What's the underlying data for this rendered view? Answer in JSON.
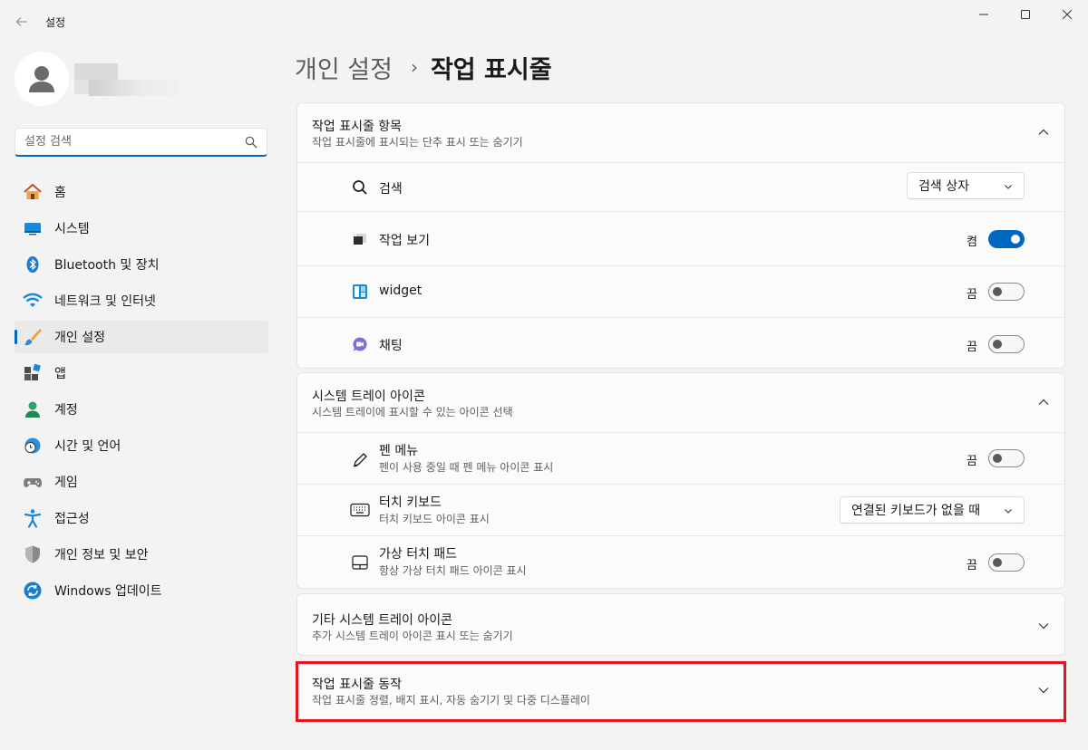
{
  "window": {
    "title": "설정"
  },
  "search": {
    "placeholder": "설정 검색"
  },
  "nav": {
    "items": [
      {
        "label": "홈",
        "icon": "home-icon"
      },
      {
        "label": "시스템",
        "icon": "system-icon"
      },
      {
        "label": "Bluetooth 및 장치",
        "icon": "bluetooth-icon"
      },
      {
        "label": "네트워크 및 인터넷",
        "icon": "wifi-icon"
      },
      {
        "label": "개인 설정",
        "icon": "brush-icon",
        "active": true
      },
      {
        "label": "앱",
        "icon": "apps-icon"
      },
      {
        "label": "계정",
        "icon": "account-icon"
      },
      {
        "label": "시간 및 언어",
        "icon": "clock-globe-icon"
      },
      {
        "label": "게임",
        "icon": "gamepad-icon"
      },
      {
        "label": "접근성",
        "icon": "accessibility-icon"
      },
      {
        "label": "개인 정보 및 보안",
        "icon": "shield-icon"
      },
      {
        "label": "Windows 업데이트",
        "icon": "update-icon"
      }
    ]
  },
  "breadcrumb": {
    "parent": "개인 설정",
    "separator": "›",
    "current": "작업 표시줄"
  },
  "taskbar_items": {
    "title": "작업 표시줄 항목",
    "subtitle": "작업 표시줄에 표시되는 단추 표시 또는 숨기기",
    "rows": [
      {
        "label": "검색",
        "control": "dropdown",
        "value": "검색 상자"
      },
      {
        "label": "작업 보기",
        "control": "toggle",
        "state": "켬",
        "on": true
      },
      {
        "label": "widget",
        "control": "toggle",
        "state": "끔",
        "on": false
      },
      {
        "label": "채팅",
        "control": "toggle",
        "state": "끔",
        "on": false
      }
    ]
  },
  "tray_icons": {
    "title": "시스템 트레이 아이콘",
    "subtitle": "시스템 트레이에 표시할 수 있는 아이콘 선택",
    "rows": [
      {
        "label": "펜 메뉴",
        "sub": "펜이 사용 중일 때 펜 메뉴 아이콘 표시",
        "control": "toggle",
        "state": "끔",
        "on": false
      },
      {
        "label": "터치 키보드",
        "sub": "터치 키보드 아이콘 표시",
        "control": "dropdown",
        "value": "연결된 키보드가 없을 때"
      },
      {
        "label": "가상 터치 패드",
        "sub": "항상 가상 터치 패드 아이콘 표시",
        "control": "toggle",
        "state": "끔",
        "on": false
      }
    ]
  },
  "other_tray": {
    "title": "기타 시스템 트레이 아이콘",
    "subtitle": "추가 시스템 트레이 아이콘 표시 또는 숨기기"
  },
  "behaviors": {
    "title": "작업 표시줄 동작",
    "subtitle": "작업 표시줄 정렬, 배지 표시, 자동 숨기기 및 다중 디스플레이"
  },
  "colors": {
    "accent": "#0067c0",
    "highlight": "#e2161e"
  }
}
